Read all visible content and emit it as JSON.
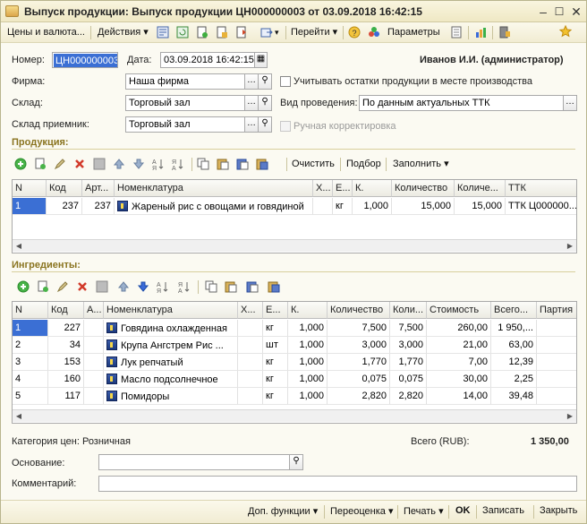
{
  "window": {
    "title": "Выпуск продукции: Выпуск продукции ЦН000000003 от 03.09.2018 16:42:15"
  },
  "toolbar": {
    "prices": "Цены и валюта...",
    "actions": "Действия",
    "goto": "Перейти",
    "params": "Параметры"
  },
  "header": {
    "number_label": "Номер:",
    "number_value": "ЦН000000003",
    "date_label": "Дата:",
    "date_value": "03.09.2018 16:42:15",
    "user": "Иванов И.И. (администратор)",
    "firm_label": "Фирма:",
    "firm_value": "Наша фирма",
    "warehouse_label": "Склад:",
    "warehouse_value": "Торговый зал",
    "receiver_label": "Склад приемник:",
    "receiver_value": "Торговый зал",
    "place_check_label": "Учитывать остатки продукции в месте производства",
    "posting_label": "Вид проведения:",
    "posting_value": "По данным актуальных ТТК",
    "manual_label": "Ручная корректировка"
  },
  "products": {
    "section_label": "Продукция:",
    "clear": "Очистить",
    "select": "Подбор",
    "fill": "Заполнить",
    "columns": [
      "N",
      "Код",
      "Арт...",
      "Номенклатура",
      "Х...",
      "Е...",
      "К.",
      "Количество",
      "Количе...",
      "ТТК"
    ],
    "rows": [
      [
        "1",
        "237",
        "237",
        "Жареный рис с овощами и говядиной",
        "",
        "кг",
        "1,000",
        "15,000",
        "15,000",
        "ТТК Ц000000..."
      ]
    ]
  },
  "ingredients": {
    "section_label": "Ингредиенты:",
    "columns": [
      "N",
      "Код",
      "А...",
      "Номенклатура",
      "Х...",
      "Е...",
      "К.",
      "Количество",
      "Коли...",
      "Стоимость",
      "Всего...",
      "Партия"
    ],
    "rows": [
      [
        "1",
        "227",
        "",
        "Говядина охлажденная",
        "",
        "кг",
        "1,000",
        "7,500",
        "7,500",
        "260,00",
        "1 950,...",
        ""
      ],
      [
        "2",
        "34",
        "",
        "Крупа Ангстрем Рис ...",
        "",
        "шт",
        "1,000",
        "3,000",
        "3,000",
        "21,00",
        "63,00",
        ""
      ],
      [
        "3",
        "153",
        "",
        "Лук репчатый",
        "",
        "кг",
        "1,000",
        "1,770",
        "1,770",
        "7,00",
        "12,39",
        ""
      ],
      [
        "4",
        "160",
        "",
        "Масло подсолнечное",
        "",
        "кг",
        "1,000",
        "0,075",
        "0,075",
        "30,00",
        "2,25",
        ""
      ],
      [
        "5",
        "117",
        "",
        "Помидоры",
        "",
        "кг",
        "1,000",
        "2,820",
        "2,820",
        "14,00",
        "39,48",
        ""
      ]
    ]
  },
  "footer": {
    "price_category": "Категория цен: Розничная",
    "total_label": "Всего (RUB):",
    "total_value": "1 350,00",
    "basis_label": "Основание:",
    "basis_value": "",
    "comment_label": "Комментарий:",
    "comment_value": ""
  },
  "bottombar": {
    "extra": "Доп. функции",
    "reprice": "Переоценка",
    "print": "Печать",
    "ok": "OK",
    "save": "Записать",
    "close": "Закрыть"
  },
  "colors": {
    "accent": "#8a7420",
    "selection": "#3b6fd4",
    "window_bg": "#fbfaf2"
  }
}
